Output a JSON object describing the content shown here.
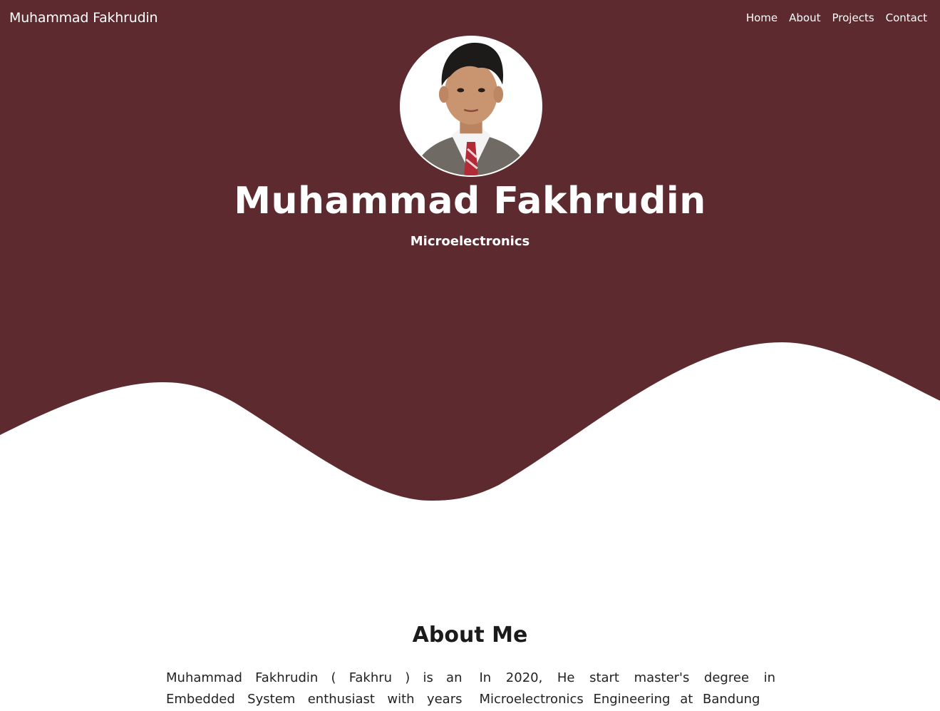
{
  "navbar": {
    "brand": "Muhammad Fakhrudin",
    "links": [
      "Home",
      "About",
      "Projects",
      "Contact"
    ]
  },
  "hero": {
    "name": "Muhammad Fakhrudin",
    "subtitle": "Microelectronics",
    "avatar_icon": "profile-photo"
  },
  "about": {
    "title": "About Me",
    "paragraph_1": "Muhammad Fakhrudin ( Fakhru ) is an Embedded System enthusiast with years of",
    "paragraph_2": "In 2020, He start master's degree in Microelectronics Engineering at Bandung"
  },
  "colors": {
    "primary": "#5c2a2f",
    "text": "#212529",
    "background": "#ffffff"
  }
}
